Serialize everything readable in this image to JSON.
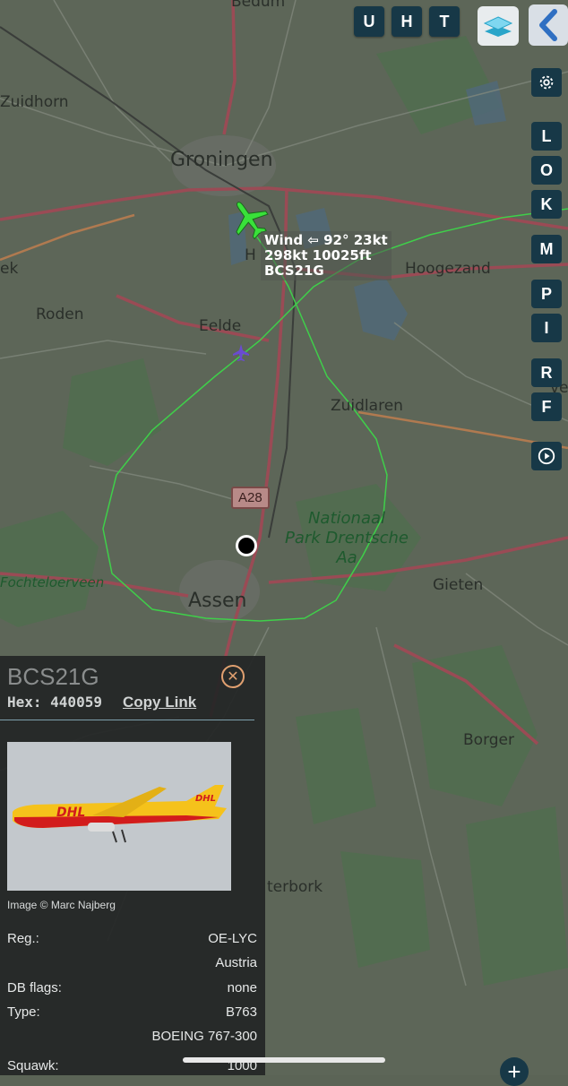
{
  "top_buttons": [
    "U",
    "H",
    "T"
  ],
  "side_buttons": [
    "L",
    "O",
    "K",
    "M",
    "P",
    "I",
    "R",
    "F"
  ],
  "map": {
    "places": {
      "bedum": "Bedum",
      "zuidhorn": "Zuidhorn",
      "groningen": "Groningen",
      "roden": "Roden",
      "eelde": "Eelde",
      "hoogezand": "Hoogezand",
      "zuidlaren": "Zuidlaren",
      "ek": "ek",
      "assen": "Assen",
      "gieten": "Gieten",
      "borger": "Borger",
      "fochteloerveen": "Fochteloerveen",
      "westerbork": "terbork",
      "haren": "H"
    },
    "park_line1": "Nationaal",
    "park_line2": "Park Drentsche",
    "park_line3": "Aa",
    "road_shield": "A28",
    "edge_ve": "ve"
  },
  "aircraft_label": {
    "line1": "Wind ⇦ 92° 23kt",
    "line2": "298kt 10025ft",
    "line3": "BCS21G"
  },
  "panel": {
    "callsign": "BCS21G",
    "hex_label": "Hex: 440059",
    "copy_link": "Copy Link",
    "image_credit": "Image © Marc Najberg",
    "photo_logo": "DHL",
    "rows": [
      {
        "label": "Reg.:",
        "value": "OE-LYC"
      },
      {
        "label": "",
        "value": "Austria"
      },
      {
        "label": "DB flags:",
        "value": "none"
      },
      {
        "label": "Type:",
        "value": "B763"
      },
      {
        "label": "",
        "value": "BOEING 767-300"
      },
      {
        "label": "Squawk:",
        "value": "1000"
      }
    ]
  },
  "colors": {
    "button_bg": "#173847",
    "track": "#3fcf4a",
    "aircraft": "#39e13a",
    "panel_bg": "#232626"
  },
  "icons": {
    "layers": "layers-icon",
    "back": "chevron-left-icon",
    "settings": "gear-icon",
    "replay": "replay-icon",
    "close": "close-icon",
    "aircraft": "airplane-icon",
    "airport": "airport-icon",
    "add": "plus-icon"
  }
}
